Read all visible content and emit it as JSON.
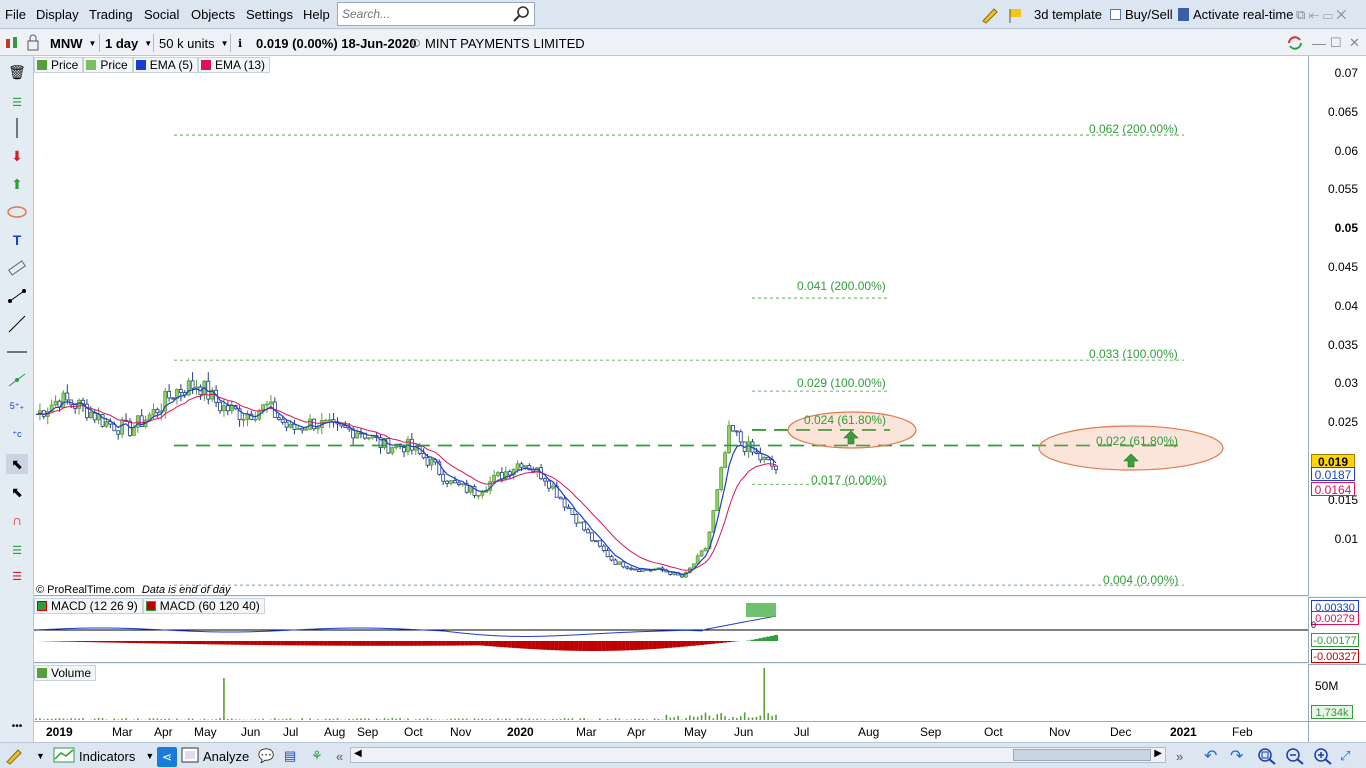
{
  "menu": [
    "File",
    "Display",
    "Trading",
    "Social",
    "Objects",
    "Settings",
    "Help"
  ],
  "search": {
    "placeholder": "Search..."
  },
  "header_right": {
    "template": "3d template",
    "buysell": "Buy/Sell",
    "realtime": "Activate real-time"
  },
  "toolbar": {
    "symbol": "MNW",
    "period": "1 day",
    "units": "50 k units",
    "quote": "0.019 (0.00%) 18-Jun-2020",
    "instrument": "MINT PAYMENTS LIMITED"
  },
  "legends": {
    "price1": "Price",
    "price2": "Price",
    "ema5": "EMA (5)",
    "ema13": "EMA (13)",
    "macd1": "MACD (12 26 9)",
    "macd2": "MACD (60 120 40)",
    "volume": "Volume"
  },
  "watermark": {
    "copyright": "© ProRealTime.com",
    "note": "Data is end of day"
  },
  "fib_labels": {
    "a_200": "0.062 (200.00%)",
    "a_100": "0.033 (100.00%)",
    "a_618": "0.022 (61.80%)",
    "a_0": "0.004 (0.00%)",
    "b_200": "0.041 (200.00%)",
    "b_100": "0.029 (100.00%)",
    "b_618": "0.024 (61.80%)",
    "b_0": "0.017 (0.00%)"
  },
  "price_axis": [
    "0.07",
    "0.065",
    "0.06",
    "0.055",
    "0.05",
    "0.045",
    "0.04",
    "0.035",
    "0.03",
    "0.025",
    "0.015",
    "0.01"
  ],
  "price_badges": {
    "last": "0.019",
    "ema5": "0.0187",
    "ema13": "0.0164"
  },
  "macd_axis": {
    "a": "0.00330",
    "b": "0.00279",
    "c": "-0.00177",
    "d": "-0.00327",
    "zero": "0"
  },
  "vol_axis": {
    "max": "50M",
    "last": "1,734k"
  },
  "date_axis": [
    "2019",
    "Mar",
    "Apr",
    "May",
    "Jun",
    "Jul",
    "Aug",
    "Sep",
    "Oct",
    "Nov",
    "2020",
    "Mar",
    "Apr",
    "May",
    "Jun",
    "Jul",
    "Aug",
    "Sep",
    "Oct",
    "Nov",
    "Dec",
    "2021",
    "Feb"
  ],
  "bottom": {
    "indicators": "Indicators",
    "analyze": "Analyze"
  },
  "colors": {
    "up": "#5a9e3a",
    "down": "#1f3b8c",
    "ema5": "#1a3fcf",
    "ema13": "#e0105a",
    "fib": "#3a9e3a",
    "ellipse": "#e07a50"
  },
  "chart_data": {
    "type": "line",
    "title": "",
    "series": [
      {
        "name": "Price",
        "values": [
          0.026,
          0.028,
          0.027,
          0.025,
          0.024,
          0.026,
          0.029,
          0.03,
          0.027,
          0.026,
          0.027,
          0.024,
          0.025,
          0.024,
          0.024,
          0.022,
          0.022,
          0.02,
          0.017,
          0.016,
          0.018,
          0.02,
          0.018,
          0.014,
          0.01,
          0.007,
          0.006,
          0.006,
          0.005,
          0.009,
          0.024,
          0.021,
          0.019
        ]
      },
      {
        "name": "EMA (5)"
      },
      {
        "name": "EMA (13)"
      }
    ],
    "ylim": [
      0.0,
      0.07
    ]
  }
}
